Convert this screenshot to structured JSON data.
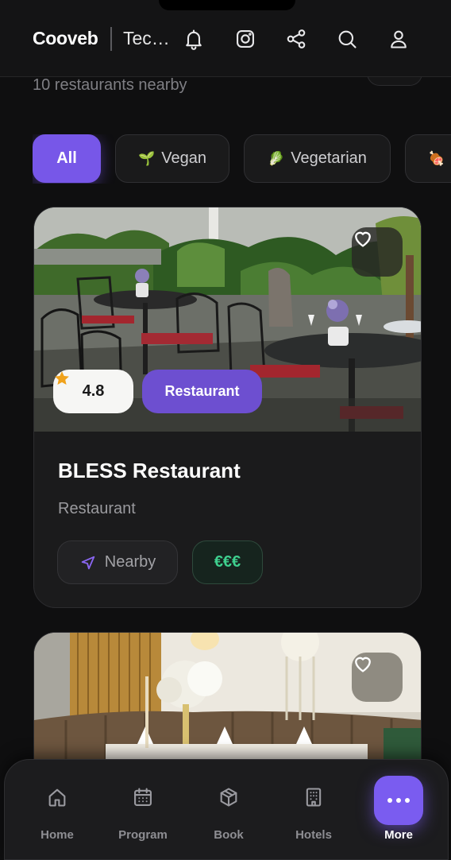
{
  "header": {
    "brand": "Cooveb",
    "section": "Technology",
    "icons": [
      "bell-icon",
      "instagram-icon",
      "share-icon",
      "search-icon",
      "user-icon"
    ]
  },
  "listing": {
    "subtitle": "10 restaurants nearby"
  },
  "filters": [
    {
      "label": "All",
      "emoji": "",
      "active": true
    },
    {
      "label": "Vegan",
      "emoji": "🌱",
      "active": false
    },
    {
      "label": "Vegetarian",
      "emoji": "🥬",
      "active": false
    },
    {
      "label": "",
      "emoji": "🍖",
      "active": false
    }
  ],
  "cards": [
    {
      "rating": "4.8",
      "type_badge": "Restaurant",
      "title": "BLESS Restaurant",
      "category": "Restaurant",
      "distance_tag": "Nearby",
      "price_tag": "€€€",
      "favorite_icon": "heart-icon"
    },
    {
      "favorite_icon": "heart-icon"
    }
  ],
  "bottom_nav": [
    {
      "label": "Home",
      "icon": "home-icon"
    },
    {
      "label": "Program",
      "icon": "calendar-icon"
    },
    {
      "label": "Book",
      "icon": "box-icon"
    },
    {
      "label": "Hotels",
      "icon": "building-icon"
    },
    {
      "label": "More",
      "icon": "more-icon",
      "active": true
    }
  ],
  "colors": {
    "accent": "#7757e8",
    "background": "#0f0f10",
    "card": "#1b1b1c",
    "price_green": "#3ecf8e",
    "star": "#f0a21b"
  }
}
